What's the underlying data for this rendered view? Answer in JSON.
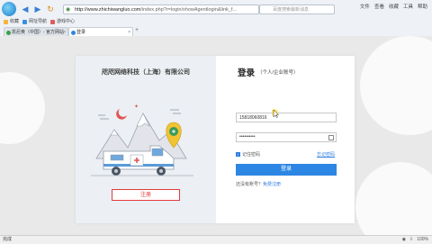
{
  "browser": {
    "url_host": "http://www.zhichiwangluo.com",
    "url_path": "/index.php?r=login/showAgentlogin&link_f...",
    "search_placeholder": "百度搜索最新消息",
    "menu": [
      "文件",
      "查看",
      "收藏",
      "工具",
      "帮助"
    ],
    "favorites": [
      "收藏",
      "网址导航",
      "游戏中心"
    ],
    "tabs": [
      {
        "label": "凯尼奥（中国）- 官方网站",
        "active": false
      },
      {
        "label": "登录",
        "active": true
      }
    ]
  },
  "left_panel": {
    "company_name": "咫咫网络科技（上海）有限公司",
    "register_label": "注册"
  },
  "login": {
    "title": "登录",
    "subtitle": "（个人/企业账号）",
    "phone_value": "15818060816",
    "password_mask": "••••••••••",
    "remember_label": "记住密码",
    "forgot_label": "忘记密码",
    "login_button": "登录",
    "no_account_text": "还没有账号？",
    "free_register": "免费注册"
  },
  "status_bar": {
    "left_text": "完成",
    "zoom": "100%"
  },
  "colors": {
    "accent_blue": "#2d86e3",
    "register_red": "#e23b3b"
  }
}
